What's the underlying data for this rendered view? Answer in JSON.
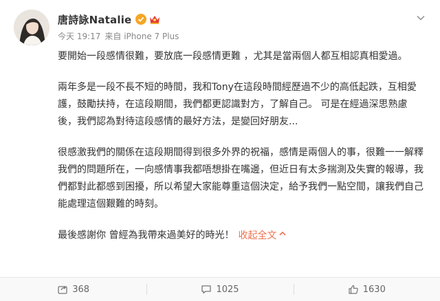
{
  "colors": {
    "text": "#333333",
    "meta": "#888888",
    "link": "#eb7350",
    "verified_badge": "#f5a623",
    "vip_badge": "#e53935"
  },
  "user": {
    "name": "唐詩詠Natalie",
    "avatar_icon": "avatar-photo",
    "verified_icon": "verified-badge-icon",
    "vip_icon": "vip-badge-icon"
  },
  "meta": {
    "time": "今天 19:17",
    "source": "来自 iPhone 7 Plus"
  },
  "post": {
    "paragraphs": [
      "要開始一段感情很難，要放底一段感情更難 ，尤其是當兩個人都互相認真相愛過。",
      "兩年多是一段不長不短的時間，我和Tony在這段時間經歷過不少的高低起跌，互相愛護，鼓勵扶持，在這段期間，我們都更認識對方，了解自己。 可是在經過深思熟慮後，我們認為對待這段感情的最好方法，是變回好朋友...",
      "很感激我們的關係在這段期間得到很多外界的祝福，感情是兩個人的事，很難一一解釋我們的問題所在，一向感情事我都唔想掛在嘴邊，但近日有太多揣測及失實的報導，我們都對此都感到困擾，所以希望大家能尊重這個決定，給予我們一點空間，讓我們自己能處理這個艱難的時刻。"
    ],
    "last_line": "最後感謝你 曾經為我帶來過美好的時光！",
    "collapse_label": "收起全文"
  },
  "actions": {
    "repost": {
      "icon": "share-icon",
      "count": "368"
    },
    "comment": {
      "icon": "comment-icon",
      "count": "1025"
    },
    "like": {
      "icon": "thumbs-up-icon",
      "count": "1630"
    }
  }
}
